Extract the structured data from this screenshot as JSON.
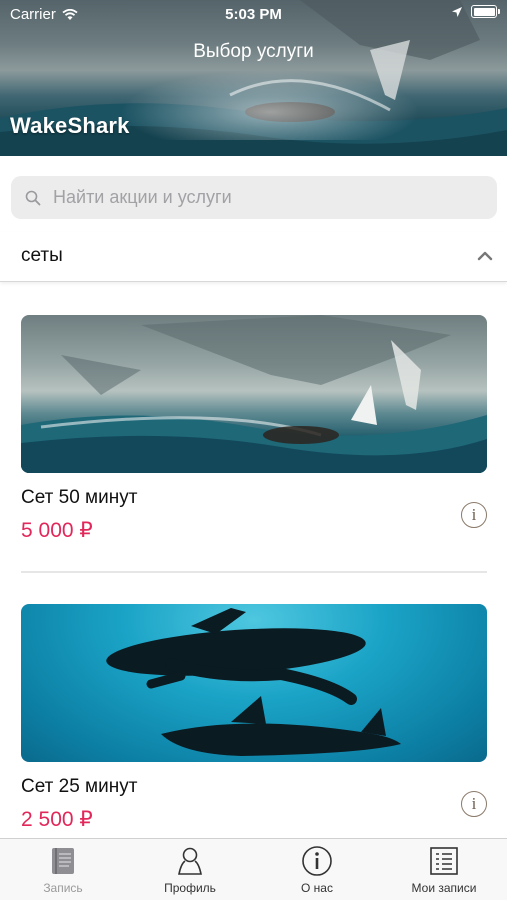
{
  "status_bar": {
    "carrier": "Carrier",
    "time": "5:03 PM"
  },
  "header": {
    "title": "Выбор услуги",
    "brand": "WakeShark"
  },
  "search": {
    "placeholder": "Найти акции и услуги",
    "value": ""
  },
  "section": {
    "label": "сеты",
    "expanded": true
  },
  "cards": [
    {
      "title": "Сет 50 минут",
      "price": "5 000 ₽",
      "image": "surfer-with-sharks"
    },
    {
      "title": "Сет 25 минут",
      "price": "2 500 ₽",
      "image": "underwater-surfer-and-shark"
    }
  ],
  "tabbar": {
    "items": [
      {
        "label": "Запись",
        "icon": "book-icon",
        "active": false
      },
      {
        "label": "Профиль",
        "icon": "person-icon",
        "active": true
      },
      {
        "label": "О нас",
        "icon": "info-icon",
        "active": true
      },
      {
        "label": "Мои записи",
        "icon": "list-icon",
        "active": true
      }
    ]
  },
  "colors": {
    "price": "#e2275a",
    "search_bg": "#ececec",
    "tabbar_bg": "#f8f8f8"
  }
}
